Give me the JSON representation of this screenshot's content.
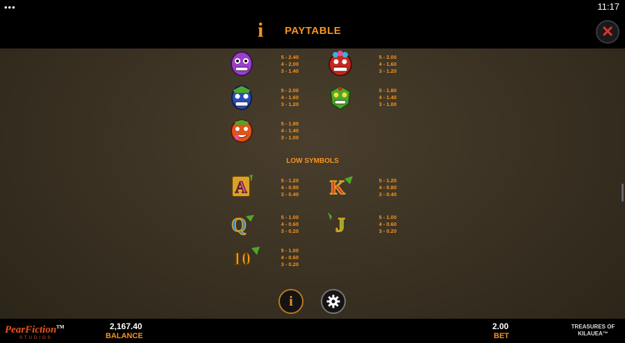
{
  "status_bar": {
    "clock": "11:17",
    "menu_dots": "•••"
  },
  "header": {
    "info_glyph": "i",
    "title": "PAYTABLE",
    "close_glyph": "✕"
  },
  "high_symbols": [
    {
      "icon": "purple-tiki-icon",
      "color": "#9b3fc9",
      "pays": [
        "5 - 2.40",
        "4 - 2.00",
        "3 - 1.40"
      ]
    },
    {
      "icon": "red-tiki-icon",
      "color": "#c8261e",
      "pays": [
        "5 - 2.00",
        "4 - 1.60",
        "3 - 1.20"
      ]
    },
    {
      "icon": "blue-tiki-icon",
      "color": "#2a4db5",
      "pays": [
        "5 - 2.00",
        "4 - 1.60",
        "3 - 1.20"
      ]
    },
    {
      "icon": "green-tiki-icon",
      "color": "#4fa62b",
      "pays": [
        "5 - 1.80",
        "4 - 1.40",
        "3 - 1.00"
      ]
    },
    {
      "icon": "orange-tiki-icon",
      "color": "#e0541c",
      "pays": [
        "5 - 1.80",
        "4 - 1.40",
        "3 - 1.00"
      ]
    }
  ],
  "low_symbols_title": "LOW SYMBOLS",
  "low_symbols": [
    {
      "icon": "letter-a-icon",
      "letter": "A",
      "color": "#e24a9a",
      "pays": [
        "5 - 1.20",
        "4 - 0.80",
        "3 - 0.40"
      ]
    },
    {
      "icon": "letter-k-icon",
      "letter": "K",
      "color": "#e33a2a",
      "pays": [
        "5 - 1.20",
        "4 - 0.80",
        "3 - 0.40"
      ]
    },
    {
      "icon": "letter-q-icon",
      "letter": "Q",
      "color": "#2a8fd8",
      "pays": [
        "5 - 1.00",
        "4 - 0.60",
        "3 - 0.20"
      ]
    },
    {
      "icon": "letter-j-icon",
      "letter": "J",
      "color": "#6bbf2a",
      "pays": [
        "5 - 1.00",
        "4 - 0.60",
        "3 - 0.20"
      ]
    },
    {
      "icon": "letter-10-icon",
      "letter": "10",
      "color": "#f29b1c",
      "pays": [
        "5 - 1.00",
        "4 - 0.60",
        "3 - 0.20"
      ]
    }
  ],
  "footer": {
    "brand": "PearFiction",
    "brand_tm": "TM",
    "studios": "STUDIOS",
    "balance_value": "2,167.40",
    "balance_label": "BALANCE",
    "bet_value": "2.00",
    "bet_label": "BET",
    "game_name_line1": "TREASURES OF",
    "game_name_line2": "KILAUEA™"
  },
  "bottom_buttons": {
    "info_glyph": "i"
  },
  "accent_color": "#f7941d"
}
